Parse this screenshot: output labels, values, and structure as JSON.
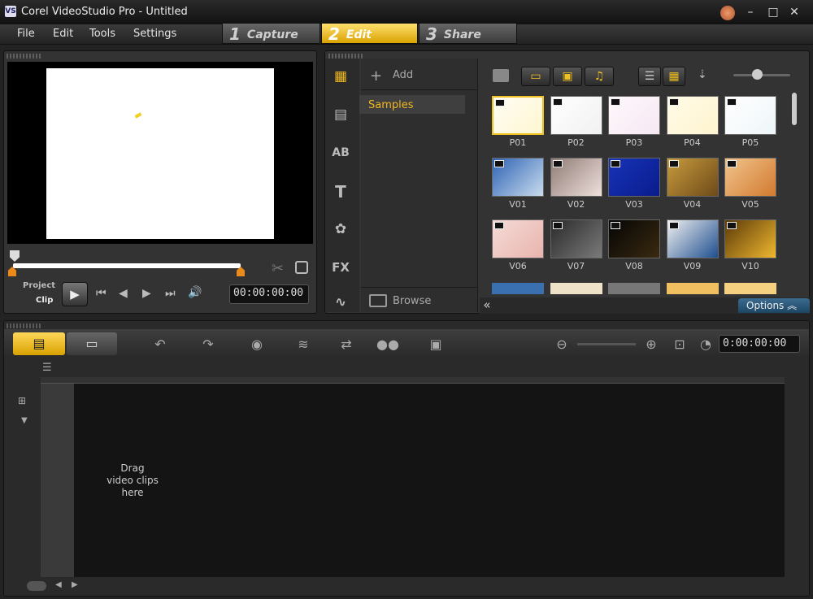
{
  "window": {
    "title": "Corel VideoStudio Pro - Untitled",
    "icon_label": "VS",
    "minimize": "–",
    "maximize": "□",
    "close": "✕"
  },
  "menu": {
    "items": [
      "File",
      "Edit",
      "Tools",
      "Settings"
    ]
  },
  "steps": [
    {
      "num": "1",
      "label": "Capture"
    },
    {
      "num": "2",
      "label": "Edit"
    },
    {
      "num": "3",
      "label": "Share"
    }
  ],
  "player": {
    "project_label": "Project",
    "clip_label": "Clip",
    "timecode": "00:00:00:00",
    "play_icon": "▶",
    "start_icon": "⏮",
    "prev_frame_icon": "◀",
    "next_frame_icon": "▶",
    "end_icon": "⏭",
    "volume_icon": "🔊",
    "scissors_icon": "✂"
  },
  "library": {
    "add_label": "Add",
    "folder_item": "Samples",
    "browse_label": "Browse",
    "options_label": "Options",
    "collapse_icon": "«",
    "tabs": [
      "media",
      "instant-project",
      "AB",
      "T",
      "graphic",
      "FX",
      "path"
    ],
    "thumbnails": [
      {
        "label": "P01",
        "colors": [
          "#fffdf6",
          "#fff6d0"
        ]
      },
      {
        "label": "P02",
        "colors": [
          "#ffffff",
          "#f1f1f1"
        ]
      },
      {
        "label": "P03",
        "colors": [
          "#fff8fc",
          "#f5e8f3"
        ]
      },
      {
        "label": "P04",
        "colors": [
          "#fffbe8",
          "#fff4cf"
        ]
      },
      {
        "label": "P05",
        "colors": [
          "#ffffff",
          "#eef6f9"
        ]
      },
      {
        "label": "V01",
        "colors": [
          "#2e63b3",
          "#c9dcef"
        ]
      },
      {
        "label": "V02",
        "colors": [
          "#8f7c76",
          "#efe0dc"
        ]
      },
      {
        "label": "V03",
        "colors": [
          "#1633b8",
          "#0a1c8c"
        ]
      },
      {
        "label": "V04",
        "colors": [
          "#c79b3d",
          "#6e4a19"
        ]
      },
      {
        "label": "V05",
        "colors": [
          "#f1c48d",
          "#d27a2f"
        ]
      },
      {
        "label": "V06",
        "colors": [
          "#f6dbd6",
          "#e8b4ae"
        ]
      },
      {
        "label": "V07",
        "colors": [
          "#2a2a2a",
          "#7a7a7a"
        ]
      },
      {
        "label": "V08",
        "colors": [
          "#050505",
          "#3a2a10"
        ]
      },
      {
        "label": "V09",
        "colors": [
          "#f0f0f0",
          "#1f4f8f"
        ]
      },
      {
        "label": "V10",
        "colors": [
          "#5b3a08",
          "#f0b830"
        ]
      }
    ]
  },
  "timeline": {
    "drop_text_1": "Drag",
    "drop_text_2": "video clips",
    "drop_text_3": "here",
    "timecode": "0:00:00:00"
  }
}
